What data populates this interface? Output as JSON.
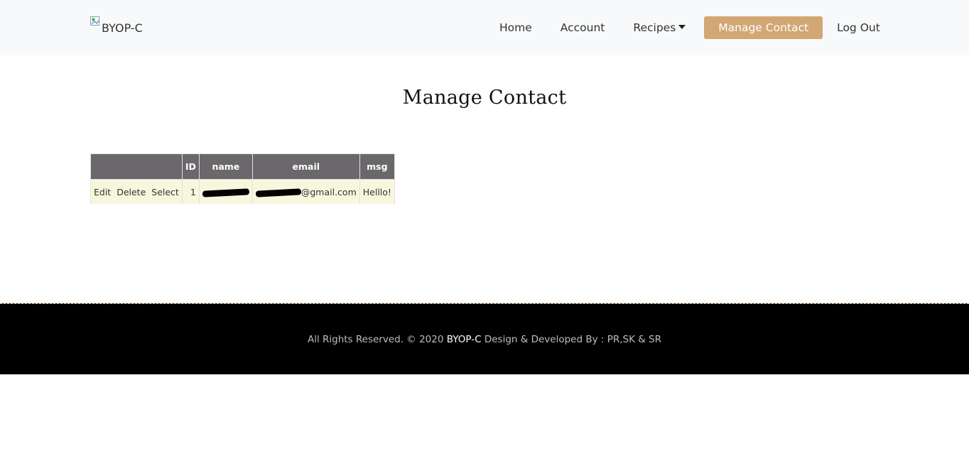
{
  "navbar": {
    "brand_alt": "BYOP-C",
    "links": {
      "home": "Home",
      "account": "Account",
      "recipes": "Recipes",
      "manage_contact": "Manage Contact",
      "logout": "Log Out"
    }
  },
  "main": {
    "title": "Manage Contact",
    "table": {
      "headers": [
        "",
        "ID",
        "name",
        "email",
        "msg"
      ],
      "rows": [
        {
          "actions": [
            "Edit",
            "Delete",
            "Select"
          ],
          "id": "1",
          "name": "",
          "email_suffix": "@gmail.com",
          "msg": "Helllo!"
        }
      ]
    }
  },
  "footer": {
    "prefix": "All Rights Reserved. © 2020",
    "brand": "BYOP-C",
    "suffix": "Design & Developed By : PR,SK & SR"
  },
  "colors": {
    "accent": "#d2a774",
    "header_bg": "#6b686b",
    "row_bg": "#f7f7de",
    "footer_bg": "#000000"
  }
}
